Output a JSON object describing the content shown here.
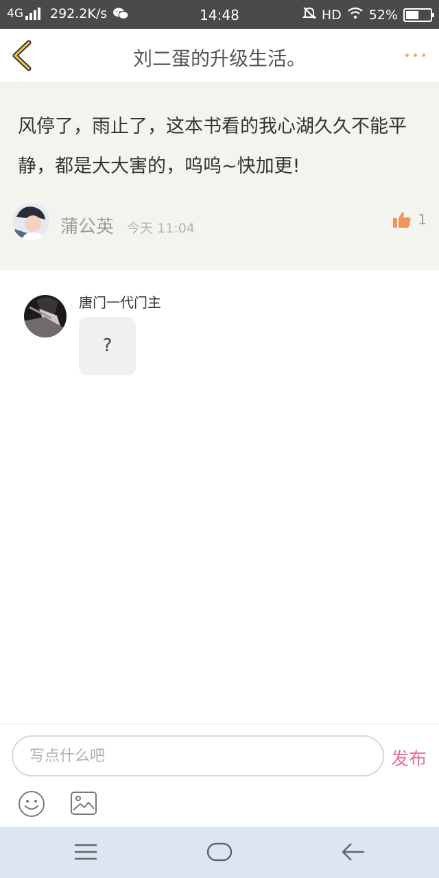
{
  "status_bar": {
    "network": "4G",
    "speed": "292.2K/s",
    "time": "14:48",
    "hd": "HD",
    "battery": "52%",
    "battery_level": 0.52
  },
  "header": {
    "title": "刘二蛋的升级生活。",
    "back_icon": "chevron-left-icon",
    "more_icon": "more-dots-icon"
  },
  "post": {
    "text": "风停了，雨止了，这本书看的我心湖久久不能平静，都是大大害的，呜呜~快加更!",
    "author": "蒲公英",
    "time": "今天 11:04",
    "likes": "1",
    "like_icon": "thumbs-up-icon"
  },
  "replies": [
    {
      "author": "唐门一代门主",
      "text": "?"
    }
  ],
  "composer": {
    "placeholder": "写点什么吧",
    "send_label": "发布",
    "emoji_icon": "emoji-icon",
    "image_icon": "image-icon"
  },
  "nav": {
    "menu_icon": "menu-icon",
    "home_icon": "home-icon",
    "back_icon": "back-arrow-icon"
  },
  "colors": {
    "accent_orange": "#f3a867",
    "send_pink": "#ea6e9e",
    "post_bg": "#f4f4ef",
    "statusbar_bg": "#4a4a4a",
    "navbar_bg": "#dce5f1"
  }
}
